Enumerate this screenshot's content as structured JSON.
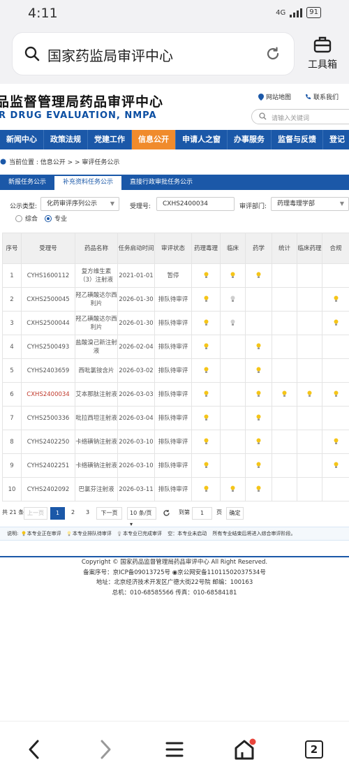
{
  "status_bar": {
    "time": "4:11",
    "network": "4G",
    "battery": "91"
  },
  "browser": {
    "url_text": "国家药监局审评中心",
    "tools_label": "工具箱"
  },
  "site": {
    "title_zh": "品监督管理局药品审评中心",
    "title_en": "R DRUG EVALUATION, NMPA",
    "sitemap_link": "网站地图",
    "contact_link": "联系我们",
    "search_placeholder": "请输入关键词",
    "nav": [
      "新闻中心",
      "政策法规",
      "党建工作",
      "信息公开",
      "申请人之窗",
      "办事服务",
      "监督与反馈",
      "登记"
    ],
    "breadcrumb": "当前位置 : 信息公开 > > 审评任务公示",
    "tabs": [
      "新报任务公示",
      "补充资料任务公示",
      "直接行政审批任务公示"
    ],
    "filter": {
      "type_label": "公示类型:",
      "type_value": "化药审评序列公示",
      "accept_label": "受理号:",
      "accept_value": "CXHS2400034",
      "dept_label": "审评部门:",
      "dept_value": "药理毒理学部",
      "radio_1": "综合",
      "radio_2": "专业"
    },
    "table": {
      "headers": [
        "序号",
        "受理号",
        "药品名称",
        "任务启动时间",
        "审评状态",
        "药理毒理",
        "临床",
        "药学",
        "统计",
        "临床药理",
        "合规"
      ],
      "rows": [
        {
          "no": "1",
          "id": "CYHS1600112",
          "name": "复方维生素（3）注射液",
          "date": "2021-01-01",
          "status": "暂停"
        },
        {
          "no": "2",
          "id": "CXHS2500045",
          "name": "羟乙磺酸达尔西利片",
          "date": "2026-01-30",
          "status": "排队待审评"
        },
        {
          "no": "3",
          "id": "CXHS2500044",
          "name": "羟乙磺酸达尔西利片",
          "date": "2026-01-30",
          "status": "排队待审评"
        },
        {
          "no": "4",
          "id": "CYHS2500493",
          "name": "盐酸溴己新注射液",
          "date": "2026-02-04",
          "status": "排队待审评"
        },
        {
          "no": "5",
          "id": "CYHS2403659",
          "name": "西吡氯铵含片",
          "date": "2026-03-02",
          "status": "排队待审评"
        },
        {
          "no": "6",
          "id": "CXHS2400034",
          "name": "艾本那肽注射液",
          "date": "2026-03-03",
          "status": "排队待审评"
        },
        {
          "no": "7",
          "id": "CYHS2500336",
          "name": "吡拉西坦注射液",
          "date": "2026-03-04",
          "status": "排队待审评"
        },
        {
          "no": "8",
          "id": "CYHS2402250",
          "name": "卡络磺钠注射液",
          "date": "2026-03-10",
          "status": "排队待审评"
        },
        {
          "no": "9",
          "id": "CYHS2402251",
          "name": "卡络磺钠注射液",
          "date": "2026-03-10",
          "status": "排队待审评"
        },
        {
          "no": "10",
          "id": "CYHS2402092",
          "name": "巴氯芬注射液",
          "date": "2026-03-11",
          "status": "排队待审评"
        }
      ]
    },
    "pager": {
      "total": "共 21 条",
      "prev": "上一页",
      "pages": [
        "1",
        "2",
        "3"
      ],
      "next": "下一页",
      "page_size": "10 条/页",
      "goto_label": "到第",
      "goto_value": "1",
      "page_unit": "页",
      "confirm": "确定"
    },
    "legend": {
      "label": "说明:",
      "item_1": "本专业正在审评",
      "item_2": "本专业排队待审评",
      "item_3": "本专业已完成审评",
      "item_4": "空：本专业未启动",
      "item_5": "所有专业结束后将进入综合审评阶段。"
    },
    "footer": {
      "copyright": "Copyright © 国家药品监督管理局药品审评中心   All Right Reserved.",
      "icp": "备案序号：京ICP备09013725号",
      "police": "京公网安备11011502037534号",
      "address": "地址：北京经济技术开发区广德大街22号院      邮编：100163",
      "phone": "总机：010-68585566      传真：010-68584181"
    }
  },
  "bottom_nav": {
    "tab_count": "2"
  },
  "colors": {
    "nav_blue": "#1b58a8",
    "active_orange": "#f08b2c",
    "bulb_yellow": "#f5c518",
    "bulb_grey": "#cfcfcf"
  }
}
